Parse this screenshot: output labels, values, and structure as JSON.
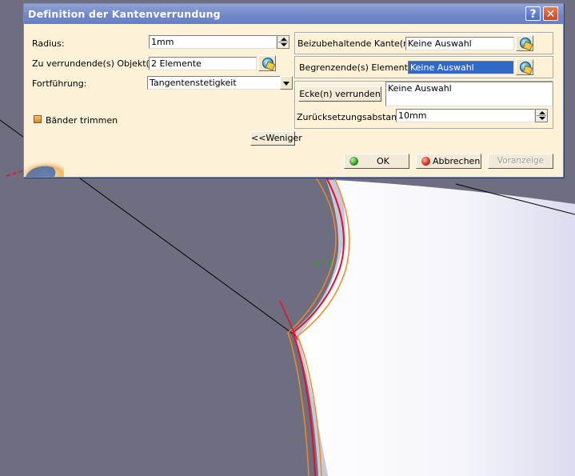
{
  "dialog": {
    "title": "Definition der Kantenverrundung",
    "help_label": "?",
    "close_label": "✕",
    "radius_label": "Radius:",
    "radius_value": "1mm",
    "objects_label": "Zu verrundende(s) Objekt(e):",
    "objects_value": "2 Elemente",
    "propagation_label": "Fortführung:",
    "propagation_value": "Tangentenstetigkeit",
    "trim_label": "Bänder trimmen",
    "keep_edges_label": "Beizubehaltende Kante(n):",
    "keep_edges_value": "Keine Auswahl",
    "limits_label": "Begrenzende(s) Element(e):",
    "limits_value": "Keine Auswahl",
    "corners_button": "Ecke(n) verrunden",
    "corners_value": "Keine Auswahl",
    "setback_label": "Zurücksetzungsabstand:",
    "setback_value": "10mm",
    "less_button": "<<Weniger",
    "ok_button": "OK",
    "cancel_button": "Abbrechen",
    "preview_button": "Voranzeige"
  },
  "viewport": {
    "annotation": "R=1"
  },
  "colors": {
    "background": "#6e6e80",
    "titlebar": "#7189c8",
    "dialog_bg": "#fdf1d8",
    "edge_red": "#e0102a",
    "edge_orange": "#f08a20"
  }
}
